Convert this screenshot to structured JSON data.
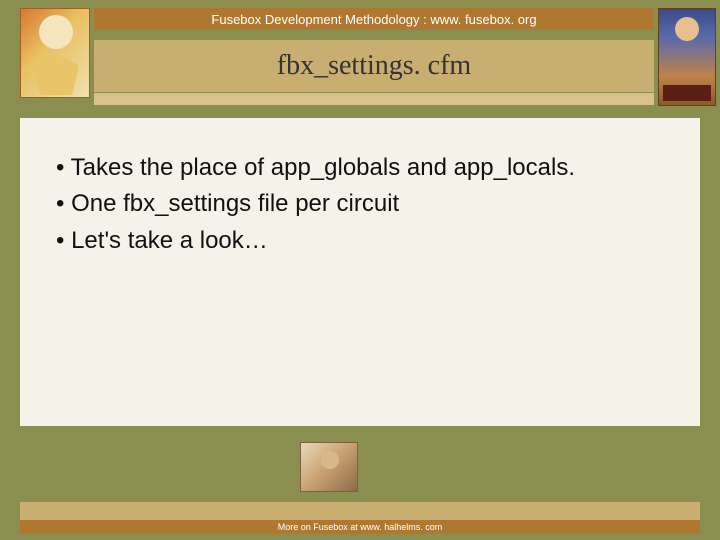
{
  "header": {
    "top_text": "Fusebox Development Methodology : www. fusebox. org",
    "title": "fbx_settings. cfm"
  },
  "bullets": [
    "Takes the place of app_globals and app_locals.",
    "One fbx_settings file per circuit",
    "Let's take a look…"
  ],
  "footer": {
    "text": "More on Fusebox at www. halhelms. com"
  }
}
